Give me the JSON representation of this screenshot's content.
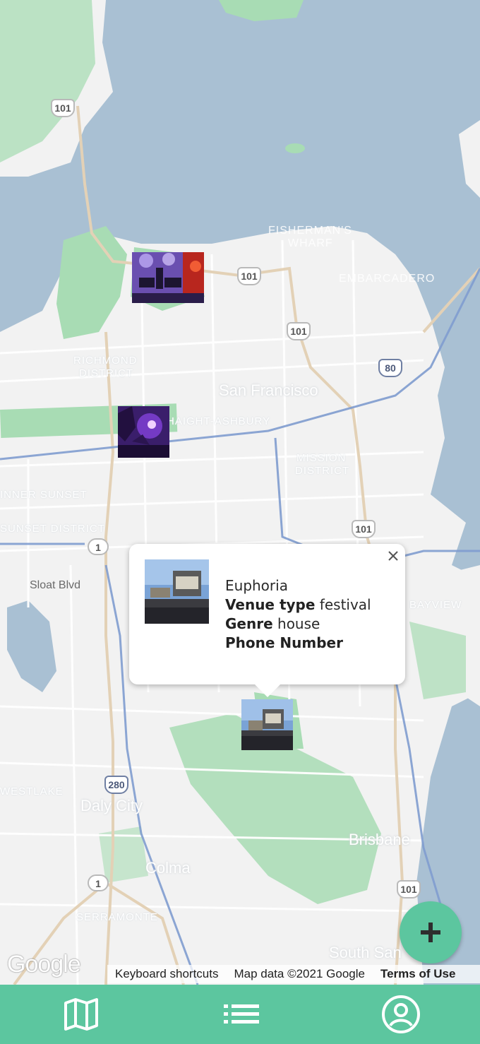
{
  "map": {
    "water_labels": [
      "FISHERMAN'S",
      "WHARF",
      "EMBARCADERO"
    ],
    "district_labels": [
      "RICHMOND",
      "DISTRICT",
      "HAIGHT-ASHBURY",
      "MISSION",
      "DISTRICT",
      "SUNSET DISTRICT",
      "INNER SUNSET",
      "BAYVIEW",
      "WESTLAKE",
      "SERRAMONTE"
    ],
    "city_labels": [
      "San Francisco",
      "Daly City",
      "Colma",
      "Brisbane",
      "South San"
    ],
    "street_labels": [
      "Sloat Blvd"
    ],
    "shields": [
      "101",
      "101",
      "101",
      "101",
      "101",
      "80",
      "1",
      "1",
      "280"
    ],
    "colors": {
      "water": "#a9c0d3",
      "land": "#f2f2f2",
      "park": "#a8dcb4",
      "highway": "#e3d1b6",
      "freeway": "#7f9ccf"
    }
  },
  "markers": [
    {
      "name": "marker-concert-stage",
      "image": "concert-stage-photo"
    },
    {
      "name": "marker-club-purple",
      "image": "club-purple-photo"
    },
    {
      "name": "marker-euphoria",
      "image": "festival-photo"
    }
  ],
  "popup": {
    "title": "Euphoria",
    "venue_type_label": "Venue type",
    "venue_type_value": "festival",
    "genre_label": "Genre",
    "genre_value": "house",
    "phone_label": "Phone Number",
    "phone_value": "",
    "close_icon": "close-icon",
    "thumbnail": "festival-photo"
  },
  "fab": {
    "icon": "plus-icon"
  },
  "footer": {
    "google_logo": "Google",
    "keyboard_shortcuts": "Keyboard shortcuts",
    "map_data": "Map data ©2021 Google",
    "terms": "Terms of Use"
  },
  "bottom_nav": {
    "items": [
      {
        "icon": "map-icon"
      },
      {
        "icon": "list-icon"
      },
      {
        "icon": "account-icon"
      }
    ],
    "color": "#5cc69f"
  }
}
